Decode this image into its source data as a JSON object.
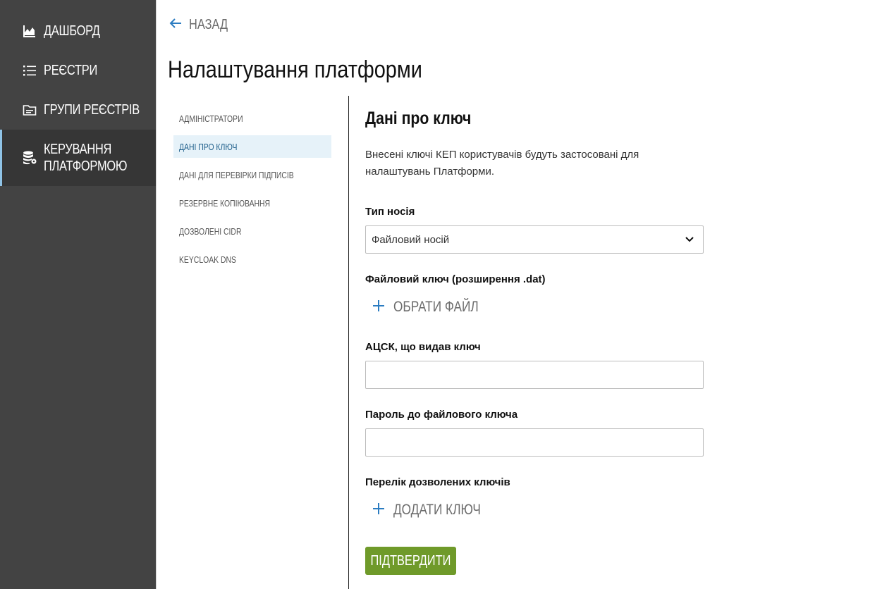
{
  "sidebar": {
    "items": [
      {
        "label": "Дашборд",
        "icon": "chart-line-icon"
      },
      {
        "label": "Реєстри",
        "icon": "list-icon"
      },
      {
        "label": "Групи реєстрів",
        "icon": "folder-icon"
      },
      {
        "label": "Керування\nплатформою",
        "icon": "database-gear-icon",
        "active": true
      }
    ]
  },
  "header": {
    "back_label": "Назад",
    "title": "Налаштування платформи"
  },
  "submenu": {
    "items": [
      {
        "label": "Адміністратори"
      },
      {
        "label": "Дані про ключ",
        "active": true
      },
      {
        "label": "Дані для перевірки підписів"
      },
      {
        "label": "Резервне копіювання"
      },
      {
        "label": "Дозволені CIDR"
      },
      {
        "label": "Keycloak DNS"
      }
    ]
  },
  "main": {
    "section_title": "Дані про ключ",
    "description": "Внесені ключі КЕП користувачів будуть застосовані для налаштувань Платформи.",
    "media_type": {
      "label": "Тип носія",
      "value": "Файловий носій"
    },
    "file_key": {
      "label": "Файловий ключ (розширення .dat)",
      "button": "Обрати файл"
    },
    "issuer": {
      "label": "АЦСК, що видав ключ",
      "value": ""
    },
    "password": {
      "label": "Пароль до файлового ключа",
      "value": ""
    },
    "allowed_keys": {
      "label": "Перелік дозволених ключів",
      "button": "Додати ключ"
    },
    "submit_label": "Підтвердити"
  },
  "colors": {
    "sidebar_bg": "#434343",
    "accent_blue": "#2b7cc1",
    "submit_green": "#6f9a2a",
    "active_submenu_bg": "#e6f2f9"
  }
}
